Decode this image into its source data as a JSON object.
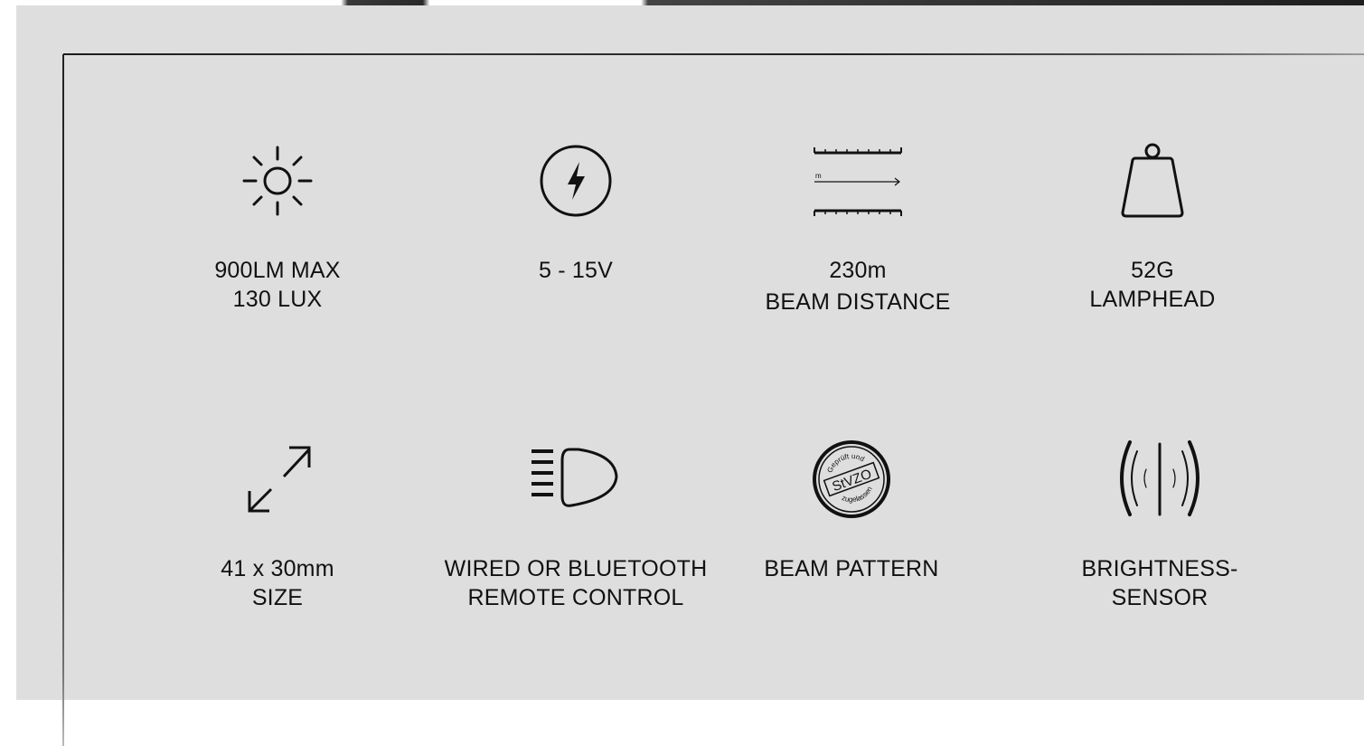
{
  "features": [
    {
      "id": "brightness",
      "icon": "sun-icon",
      "line1": "900LM MAX",
      "line2": "130 LUX"
    },
    {
      "id": "voltage",
      "icon": "lightning-circle-icon",
      "line1": "5 - 15V",
      "line2": ""
    },
    {
      "id": "beam-distance",
      "icon": "ruler-distance-icon",
      "icon_text": "m",
      "line1": "230m",
      "line2": "BEAM DISTANCE"
    },
    {
      "id": "weight",
      "icon": "weight-icon",
      "line1": "52G",
      "line2": "LAMPHEAD"
    },
    {
      "id": "size",
      "icon": "diagonal-arrows-icon",
      "line1": "41 x 30mm",
      "line2": "SIZE"
    },
    {
      "id": "remote",
      "icon": "headlight-icon",
      "line1": "WIRED OR BLUETOOTH",
      "line2": "REMOTE CONTROL"
    },
    {
      "id": "beam-pattern",
      "icon": "stvzo-seal-icon",
      "line1": "BEAM PATTERN",
      "line2": "",
      "seal_text": {
        "top": "Geprüft und",
        "center": "StVZO",
        "bottom": "zugelassen"
      }
    },
    {
      "id": "sensor",
      "icon": "sensor-waves-icon",
      "line1": "BRIGHTNESS-",
      "line2": "SENSOR"
    }
  ],
  "colors": {
    "panel": "#dedede",
    "ink": "#111111"
  }
}
